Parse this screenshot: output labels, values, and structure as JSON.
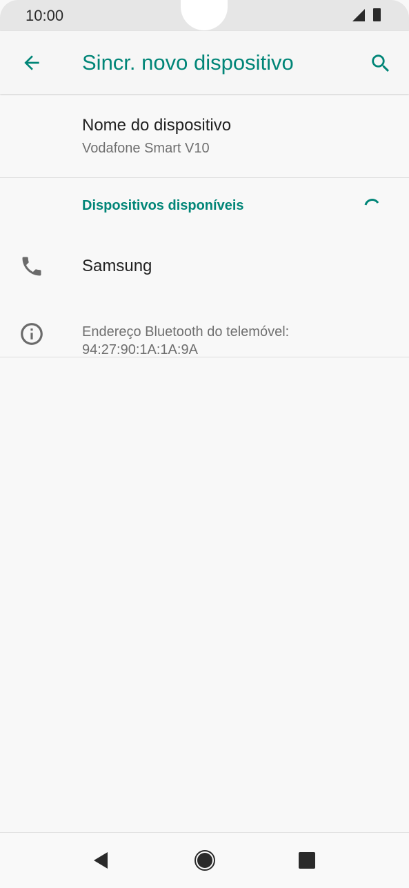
{
  "status_bar": {
    "time": "10:00",
    "icons": [
      "signal-icon",
      "battery-icon"
    ]
  },
  "app_bar": {
    "title": "Sincr. novo dispositivo",
    "back_icon": "arrow-back-icon",
    "search_icon": "search-icon"
  },
  "device_name": {
    "title": "Nome do dispositivo",
    "value": "Vodafone Smart V10"
  },
  "available_devices": {
    "header": "Dispositivos disponíveis",
    "loading_icon": "progress-spinner-icon",
    "items": [
      {
        "label": "Samsung",
        "icon": "phone-icon"
      }
    ]
  },
  "info": {
    "icon": "info-icon",
    "text_line1": "Endereço Bluetooth do telemóvel:",
    "text_line2": "94:27:90:1A:1A:9A"
  },
  "nav_bar": {
    "back_icon": "nav-back-icon",
    "home_icon": "nav-home-icon",
    "recents_icon": "nav-recents-icon"
  },
  "colors": {
    "accent": "#008577",
    "background": "#f8f8f8",
    "primary_text": "#212121",
    "secondary_text": "#6f6f6f"
  }
}
